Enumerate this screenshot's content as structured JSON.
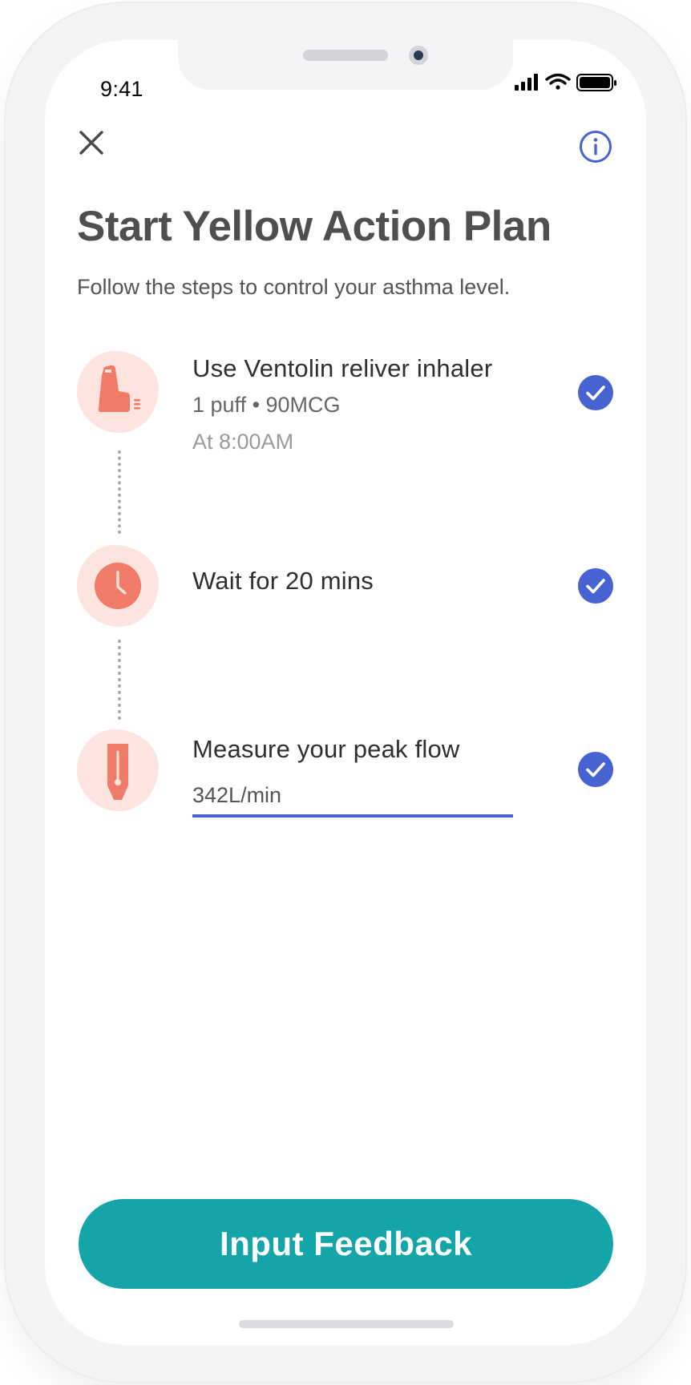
{
  "status_bar": {
    "time": "9:41"
  },
  "header": {
    "close_icon": "close-icon",
    "info_icon": "info-icon"
  },
  "page": {
    "title": "Start Yellow Action Plan",
    "subtitle": "Follow the steps to control your asthma level."
  },
  "steps": [
    {
      "icon": "inhaler-icon",
      "title": "Use Ventolin reliver inhaler",
      "detail": "1 puff • 90MCG",
      "time": "At 8:00AM",
      "completed": true
    },
    {
      "icon": "clock-icon",
      "title": "Wait for 20 mins",
      "completed": true
    },
    {
      "icon": "peak-flow-meter-icon",
      "title": "Measure your peak flow",
      "input_value": "342L/min",
      "completed": true
    }
  ],
  "footer": {
    "cta_label": "Input Feedback"
  },
  "colors": {
    "accent_blue": "#4763d1",
    "teal_button": "#14a5a9",
    "coral_icon": "#f07b68",
    "icon_bg": "#fde4df",
    "title_gray": "#4f4f4f"
  }
}
